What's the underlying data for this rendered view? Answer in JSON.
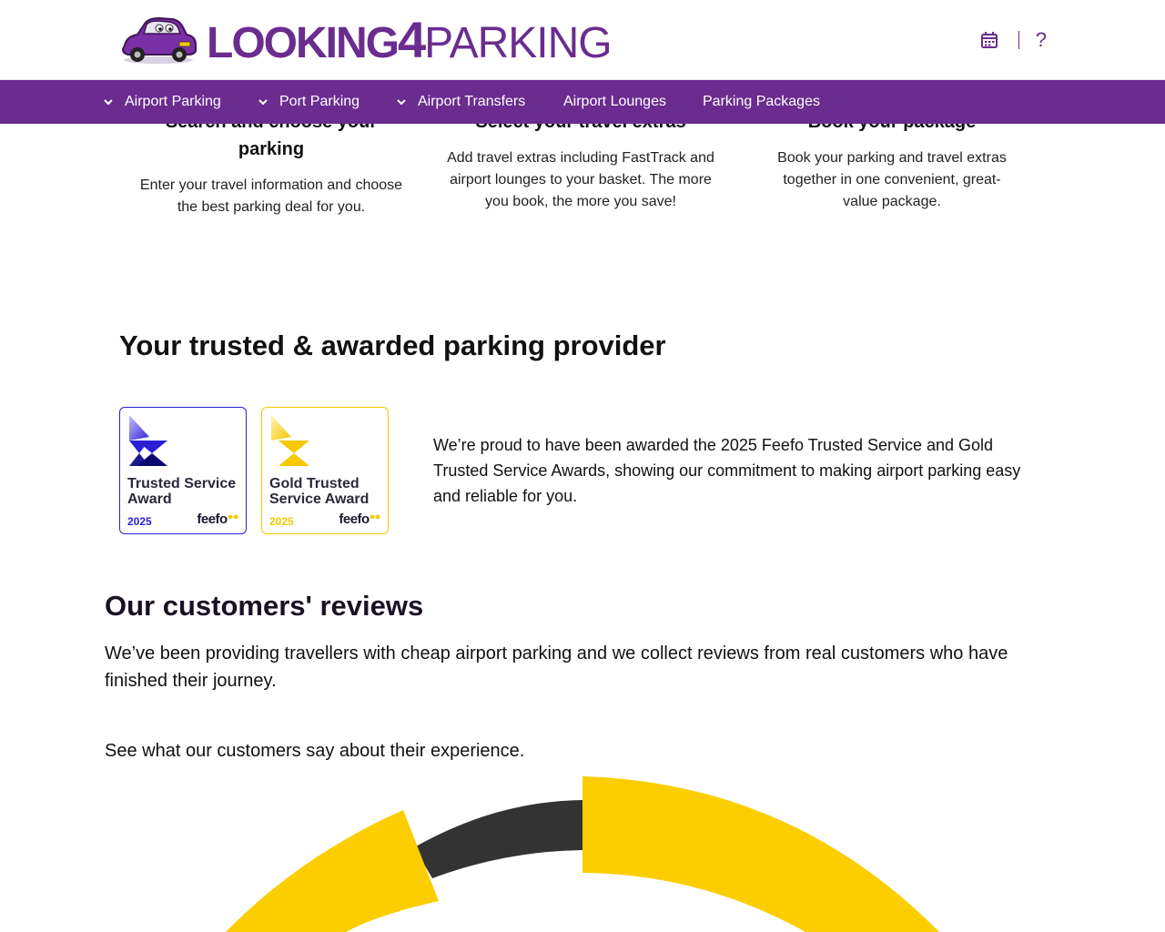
{
  "header": {
    "logo": {
      "looking": "LOOKING",
      "four": "4",
      "parking": "PARKING"
    },
    "calendar_icon": "calendar-icon",
    "help_label": "?"
  },
  "nav": {
    "items": [
      {
        "label": "Airport Parking",
        "has_dropdown": true
      },
      {
        "label": "Port Parking",
        "has_dropdown": true
      },
      {
        "label": "Airport Transfers",
        "has_dropdown": true
      },
      {
        "label": "Airport Lounges",
        "has_dropdown": false
      },
      {
        "label": "Parking Packages",
        "has_dropdown": false
      }
    ]
  },
  "steps": [
    {
      "title": "Search and choose your parking",
      "text": "Enter your travel information and choose the best parking deal for you."
    },
    {
      "title": "Select your travel extras",
      "text": "Add travel extras including FastTrack and airport lounges to your basket. The more you book, the more you save!"
    },
    {
      "title": "Book your package",
      "text": "Book your parking and travel extras together in one convenient, great-value package."
    }
  ],
  "trusted": {
    "title": "Your trusted & awarded parking provider",
    "badges": [
      {
        "name": "Trusted Service Award",
        "year": "2025",
        "brand": "feefo",
        "color": "#2b1fd6"
      },
      {
        "name": "Gold Trusted Service Award",
        "year": "2025",
        "brand": "feefo",
        "color": "#f5c800"
      }
    ],
    "text": "We’re proud to have been awarded the 2025 Feefo Trusted Service and Gold Trusted Service Awards, showing our commitment to making airport parking easy and reliable for you."
  },
  "reviews": {
    "title": "Our customers' reviews",
    "text": "We’ve been providing travellers with cheap airport parking and we collect reviews from real customers who have finished their journey.",
    "sub": "See what our customers say about their experience."
  },
  "colors": {
    "brand_purple": "#6a2c8f",
    "gold": "#fcce00",
    "dark_gray": "#333333"
  }
}
